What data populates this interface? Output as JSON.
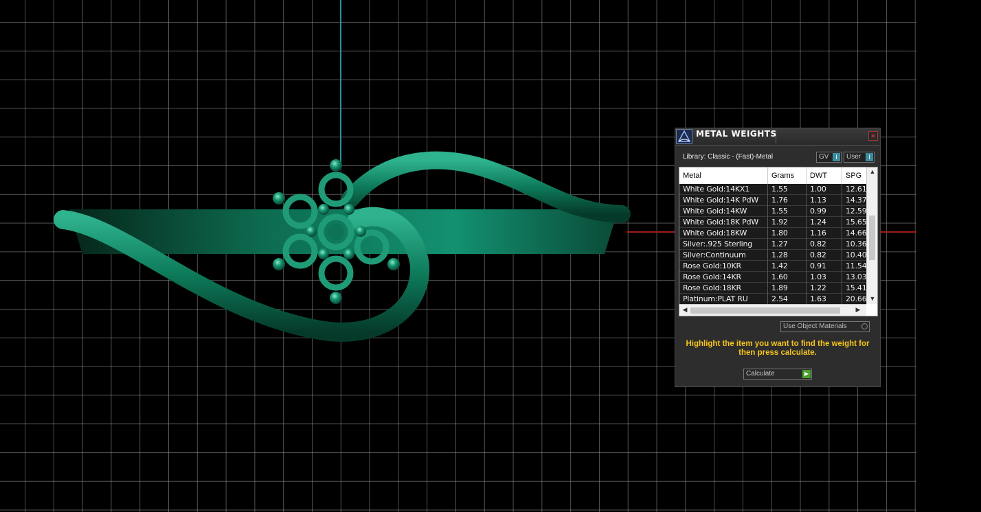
{
  "dialog": {
    "title": "METAL WEIGHTS",
    "close_label": "×",
    "library": "Library: Classic - (Fast)-Metal",
    "toggles": {
      "gv": "GV",
      "user": "User",
      "knob": "I"
    },
    "columns": [
      "Metal",
      "Grams",
      "DWT",
      "SPG"
    ],
    "rows": [
      {
        "metal": "White Gold:14KX1",
        "grams": "1.55",
        "dwt": "1.00",
        "spg": "12.61"
      },
      {
        "metal": "White Gold:14K PdW",
        "grams": "1.76",
        "dwt": "1.13",
        "spg": "14.37"
      },
      {
        "metal": "White Gold:14KW",
        "grams": "1.55",
        "dwt": "0.99",
        "spg": "12.59"
      },
      {
        "metal": "White Gold:18K PdW",
        "grams": "1.92",
        "dwt": "1.24",
        "spg": "15.65"
      },
      {
        "metal": "White Gold:18KW",
        "grams": "1.80",
        "dwt": "1.16",
        "spg": "14.66"
      },
      {
        "metal": "Silver:.925 Sterling",
        "grams": "1.27",
        "dwt": "0.82",
        "spg": "10.36"
      },
      {
        "metal": "Silver:Continuum",
        "grams": "1.28",
        "dwt": "0.82",
        "spg": "10.40"
      },
      {
        "metal": "Rose Gold:10KR",
        "grams": "1.42",
        "dwt": "0.91",
        "spg": "11.54"
      },
      {
        "metal": "Rose Gold:14KR",
        "grams": "1.60",
        "dwt": "1.03",
        "spg": "13.03"
      },
      {
        "metal": "Rose Gold:18KR",
        "grams": "1.89",
        "dwt": "1.22",
        "spg": "15.41"
      },
      {
        "metal": "Platinum:PLAT RU",
        "grams": "2.54",
        "dwt": "1.63",
        "spg": "20.66"
      }
    ],
    "use_object_materials": "Use Object Materials",
    "instructions": "Highlight the item you want to find the weight for then press calculate.",
    "calculate_label": "Calculate",
    "calculate_icon": "play-icon"
  },
  "colors": {
    "accent": "#f7c51c",
    "model_green": "#0f7a5c",
    "y_axis": "#2f8f9b",
    "x_axis": "#a01c1c",
    "toggle_knob": "#3b8ea0",
    "go_button": "#4aa02c"
  }
}
